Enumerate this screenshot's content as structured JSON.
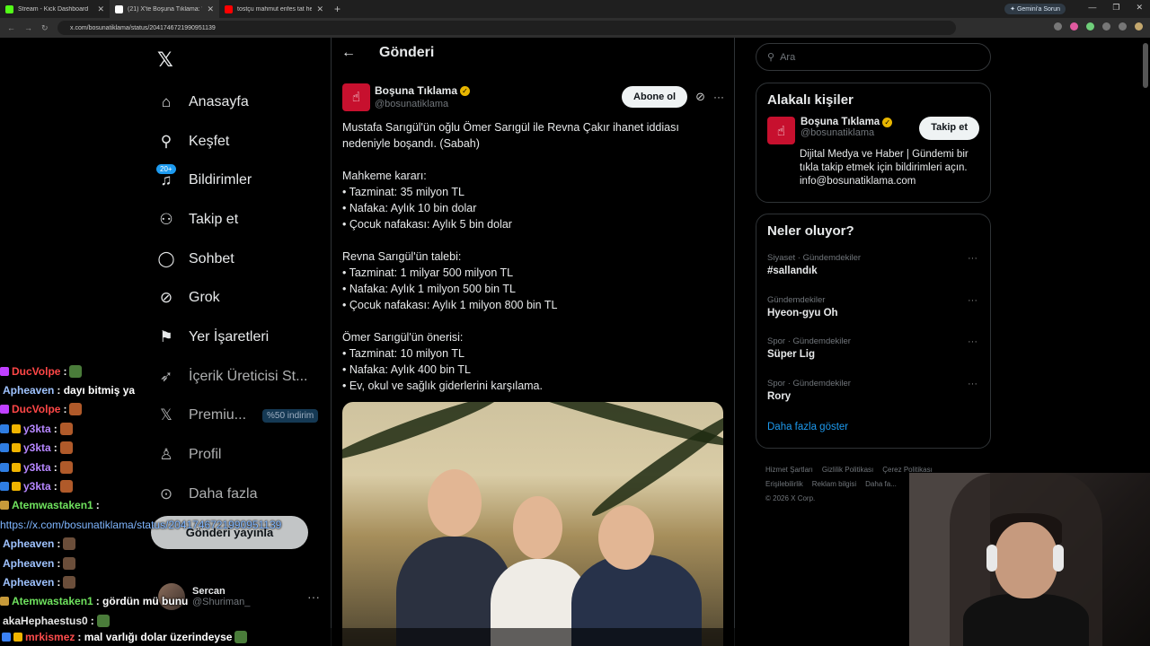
{
  "browser": {
    "tabs": [
      {
        "label": "Stream - Kick Dashboard",
        "color": "#53fc18",
        "active": false
      },
      {
        "label": "(21) X'te Boşuna Tıklama: \"Mus...",
        "color": "#ffffff",
        "active": true
      },
      {
        "label": "tostçu mahmut enfes tat her ya...",
        "color": "#ff0000",
        "active": false
      }
    ],
    "gemini_label": "Gemini'a Sorun",
    "url": "x.com/bosunatiklama/status/2041746721990951139"
  },
  "x": {
    "nav": [
      {
        "icon": "home-icon",
        "glyph": "⌂",
        "label": "Anasayfa",
        "dim": false
      },
      {
        "icon": "search-icon",
        "glyph": "⚲",
        "label": "Keşfet",
        "dim": false
      },
      {
        "icon": "bell-icon",
        "glyph": "♫",
        "label": "Bildirimler",
        "dim": false,
        "badge": "20+"
      },
      {
        "icon": "follow-icon",
        "glyph": "⚇",
        "label": "Takip et",
        "dim": false
      },
      {
        "icon": "chat-icon",
        "glyph": "◯",
        "label": "Sohbet",
        "dim": false
      },
      {
        "icon": "grok-icon",
        "glyph": "⊘",
        "label": "Grok",
        "dim": false
      },
      {
        "icon": "bookmark-icon",
        "glyph": "⚑",
        "label": "Yer İşaretleri",
        "dim": false
      },
      {
        "icon": "rocket-icon",
        "glyph": "➶",
        "label": "İçerik Üreticisi St...",
        "dim": true
      },
      {
        "icon": "x-logo-icon",
        "glyph": "𝕏",
        "label": "Premiu...",
        "dim": true,
        "promo": "%50 indirim"
      },
      {
        "icon": "profile-icon",
        "glyph": "♙",
        "label": "Profil",
        "dim": true
      },
      {
        "icon": "more-circle-icon",
        "glyph": "⊙",
        "label": "Daha fazla",
        "dim": true
      }
    ],
    "post_button": "Gönderi yayınla",
    "account": {
      "name": "Sercan",
      "handle": "@Shuriman_"
    },
    "header_title": "Gönderi",
    "author": {
      "name": "Boşuna Tıklama",
      "handle": "@bosunatiklama",
      "subscribe": "Abone ol"
    },
    "tweet_lines": [
      "Mustafa Sarıgül'ün oğlu Ömer Sarıgül ile Revna Çakır ihanet iddiası",
      "nedeniyle boşandı. (Sabah)",
      "",
      "Mahkeme kararı:",
      "• Tazminat: 35 milyon TL",
      "• Nafaka: Aylık 10 bin dolar",
      "• Çocuk nafakası: Aylık 5 bin dolar",
      "",
      "Revna Sarıgül'ün talebi:",
      "• Tazminat: 1 milyar 500 milyon TL",
      "• Nafaka: Aylık 1 milyon 500 bin TL",
      "• Çocuk nafakası: Aylık 1 milyon 800 bin TL",
      "",
      "Ömer Sarıgül'ün önerisi:",
      "• Tazminat: 10 milyon TL",
      "• Nafaka: Aylık 400 bin TL",
      "• Ev, okul ve sağlık giderlerini karşılama."
    ],
    "search_placeholder": "Ara",
    "related": {
      "title": "Alakalı kişiler",
      "name": "Boşuna Tıklama",
      "handle": "@bosunatiklama",
      "follow": "Takip et",
      "bio": "Dijital Medya ve Haber | Gündemi bir tıkla takip etmek için bildirimleri açın. info@bosunatiklama.com"
    },
    "trends": {
      "title": "Neler oluyor?",
      "items": [
        {
          "category": "Siyaset · Gündemdekiler",
          "name": "#sallandık"
        },
        {
          "category": "Gündemdekiler",
          "name": "Hyeon-gyu Oh"
        },
        {
          "category": "Spor · Gündemdekiler",
          "name": "Süper Lig"
        },
        {
          "category": "Spor · Gündemdekiler",
          "name": "Rory"
        }
      ],
      "show_more": "Daha fazla göster"
    },
    "footer": [
      "Hizmet Şartları",
      "Gizlilik Politikası",
      "Çerez Politikası",
      "Erişilebilirlik",
      "Reklam bilgisi",
      "Daha fa...",
      "© 2026 X Corp."
    ]
  },
  "chat": [
    {
      "user": "DucVolpe",
      "cls": "u-red",
      "text": ":",
      "emote": "g"
    },
    {
      "user": "Apheaven",
      "cls": "u-blue",
      "text": ": dayı bitmiş ya"
    },
    {
      "user": "DucVolpe",
      "cls": "u-red",
      "text": ":",
      "emote": "o"
    },
    {
      "user": "y3kta",
      "cls": "u-purple",
      "text": ":",
      "emote": "o"
    },
    {
      "user": "y3kta",
      "cls": "u-purple",
      "text": ":",
      "emote": "o"
    },
    {
      "user": "y3kta",
      "cls": "u-purple",
      "text": ":",
      "emote": "o"
    },
    {
      "user": "y3kta",
      "cls": "u-purple",
      "text": ":",
      "emote": "o"
    },
    {
      "user": "Atemwastaken1",
      "cls": "u-green",
      "text": ":"
    },
    {
      "user": "",
      "cls": "",
      "text": "",
      "link": "https://x.com/bosunatiklama/status/2041746721990951139"
    },
    {
      "user": "Apheaven",
      "cls": "u-blue",
      "text": ":",
      "emote": "p"
    },
    {
      "user": "Apheaven",
      "cls": "u-blue",
      "text": ":",
      "emote": "p"
    },
    {
      "user": "Apheaven",
      "cls": "u-blue",
      "text": ":",
      "emote": "p"
    },
    {
      "user": "Atemwastaken1",
      "cls": "u-green",
      "text": ": gördün mü bunu"
    },
    {
      "user": "akaHephaestus0",
      "cls": "u-white",
      "text": ":",
      "emote": "g"
    }
  ],
  "chat_last": {
    "user": "mrkismez",
    "text": ": mal varlığı dolar üzerindeyse"
  }
}
